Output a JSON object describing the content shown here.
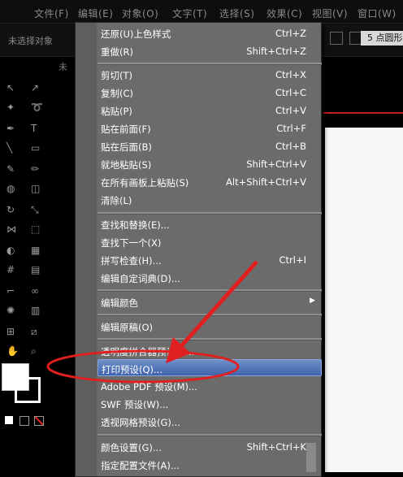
{
  "menubar": {
    "items": [
      "文件(F)",
      "编辑(E)",
      "对象(O)",
      "文字(T)",
      "选择(S)",
      "效果(C)",
      "视图(V)",
      "窗口(W)"
    ]
  },
  "control_bar": {
    "no_selection": "未选择对象",
    "point_dropdown": "5 点圆形"
  },
  "document_tab": "未",
  "edit_menu": {
    "items": [
      {
        "label": "还原(U)上色样式",
        "shortcut": "Ctrl+Z"
      },
      {
        "label": "重做(R)",
        "shortcut": "Shift+Ctrl+Z"
      },
      {
        "label": "剪切(T)",
        "shortcut": "Ctrl+X"
      },
      {
        "label": "复制(C)",
        "shortcut": "Ctrl+C"
      },
      {
        "label": "粘贴(P)",
        "shortcut": "Ctrl+V"
      },
      {
        "label": "贴在前面(F)",
        "shortcut": "Ctrl+F"
      },
      {
        "label": "贴在后面(B)",
        "shortcut": "Ctrl+B"
      },
      {
        "label": "就地粘贴(S)",
        "shortcut": "Shift+Ctrl+V"
      },
      {
        "label": "在所有画板上粘贴(S)",
        "shortcut": "Alt+Shift+Ctrl+V"
      },
      {
        "label": "清除(L)",
        "shortcut": ""
      },
      {
        "label": "查找和替换(E)...",
        "shortcut": ""
      },
      {
        "label": "查找下一个(X)",
        "shortcut": ""
      },
      {
        "label": "拼写检查(H)...",
        "shortcut": "Ctrl+I"
      },
      {
        "label": "编辑自定词典(D)...",
        "shortcut": ""
      },
      {
        "label": "编辑颜色",
        "shortcut": ""
      },
      {
        "label": "编辑原稿(O)",
        "shortcut": ""
      },
      {
        "label": "透明度拼合器预设(J)...",
        "shortcut": ""
      },
      {
        "label": "打印预设(Q)...",
        "shortcut": ""
      },
      {
        "label": "Adobe PDF 预设(M)...",
        "shortcut": ""
      },
      {
        "label": "SWF 预设(W)...",
        "shortcut": ""
      },
      {
        "label": "透视网格预设(G)...",
        "shortcut": ""
      },
      {
        "label": "颜色设置(G)...",
        "shortcut": "Shift+Ctrl+K"
      },
      {
        "label": "指定配置文件(A)...",
        "shortcut": ""
      }
    ],
    "submenu_arrow": "▶"
  },
  "colors": {
    "highlight": "#4a6db5",
    "annotation_red": "#e02020"
  }
}
